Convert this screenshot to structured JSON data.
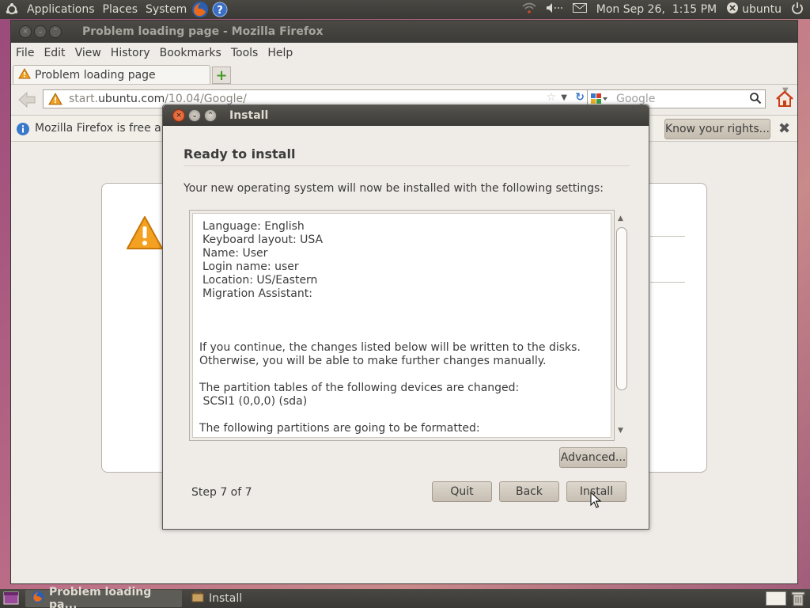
{
  "top_panel": {
    "menus": [
      "Applications",
      "Places",
      "System"
    ],
    "clock": "Mon Sep 26,  1:15 PM",
    "user": "ubuntu"
  },
  "firefox": {
    "window_title": "Problem loading page - Mozilla Firefox",
    "menu": [
      "File",
      "Edit",
      "View",
      "History",
      "Bookmarks",
      "Tools",
      "Help"
    ],
    "tab_label": "Problem loading page",
    "url_prefix": "start.",
    "url_host": "ubuntu.com",
    "url_path": "/10.04/Google/",
    "search_placeholder": "Google",
    "notification_text": "Mozilla Firefox is free an",
    "know_rights_label": "Know your rights..."
  },
  "install": {
    "title": "Install",
    "heading": "Ready to install",
    "intro": "Your new operating system will now be installed with the following settings:",
    "summary_lines": [
      "Language: English",
      "Keyboard layout: USA",
      "Name: User",
      "Login name: user",
      "Location: US/Eastern",
      "Migration Assistant:"
    ],
    "continue_lines": [
      "If you continue, the changes listed below will be written to the disks.",
      "Otherwise, you will be able to make further changes manually."
    ],
    "partition_heading": "The partition tables of the following devices are changed:",
    "partition_device": " SCSI1 (0,0,0) (sda)",
    "format_heading": "The following partitions are going to be formatted:",
    "advanced_label": "Advanced...",
    "step_text": "Step 7 of 7",
    "quit_label": "Quit",
    "back_label": "Back",
    "install_label": "Install"
  },
  "taskbar": {
    "items": [
      "Problem loading pa...",
      "Install"
    ]
  }
}
